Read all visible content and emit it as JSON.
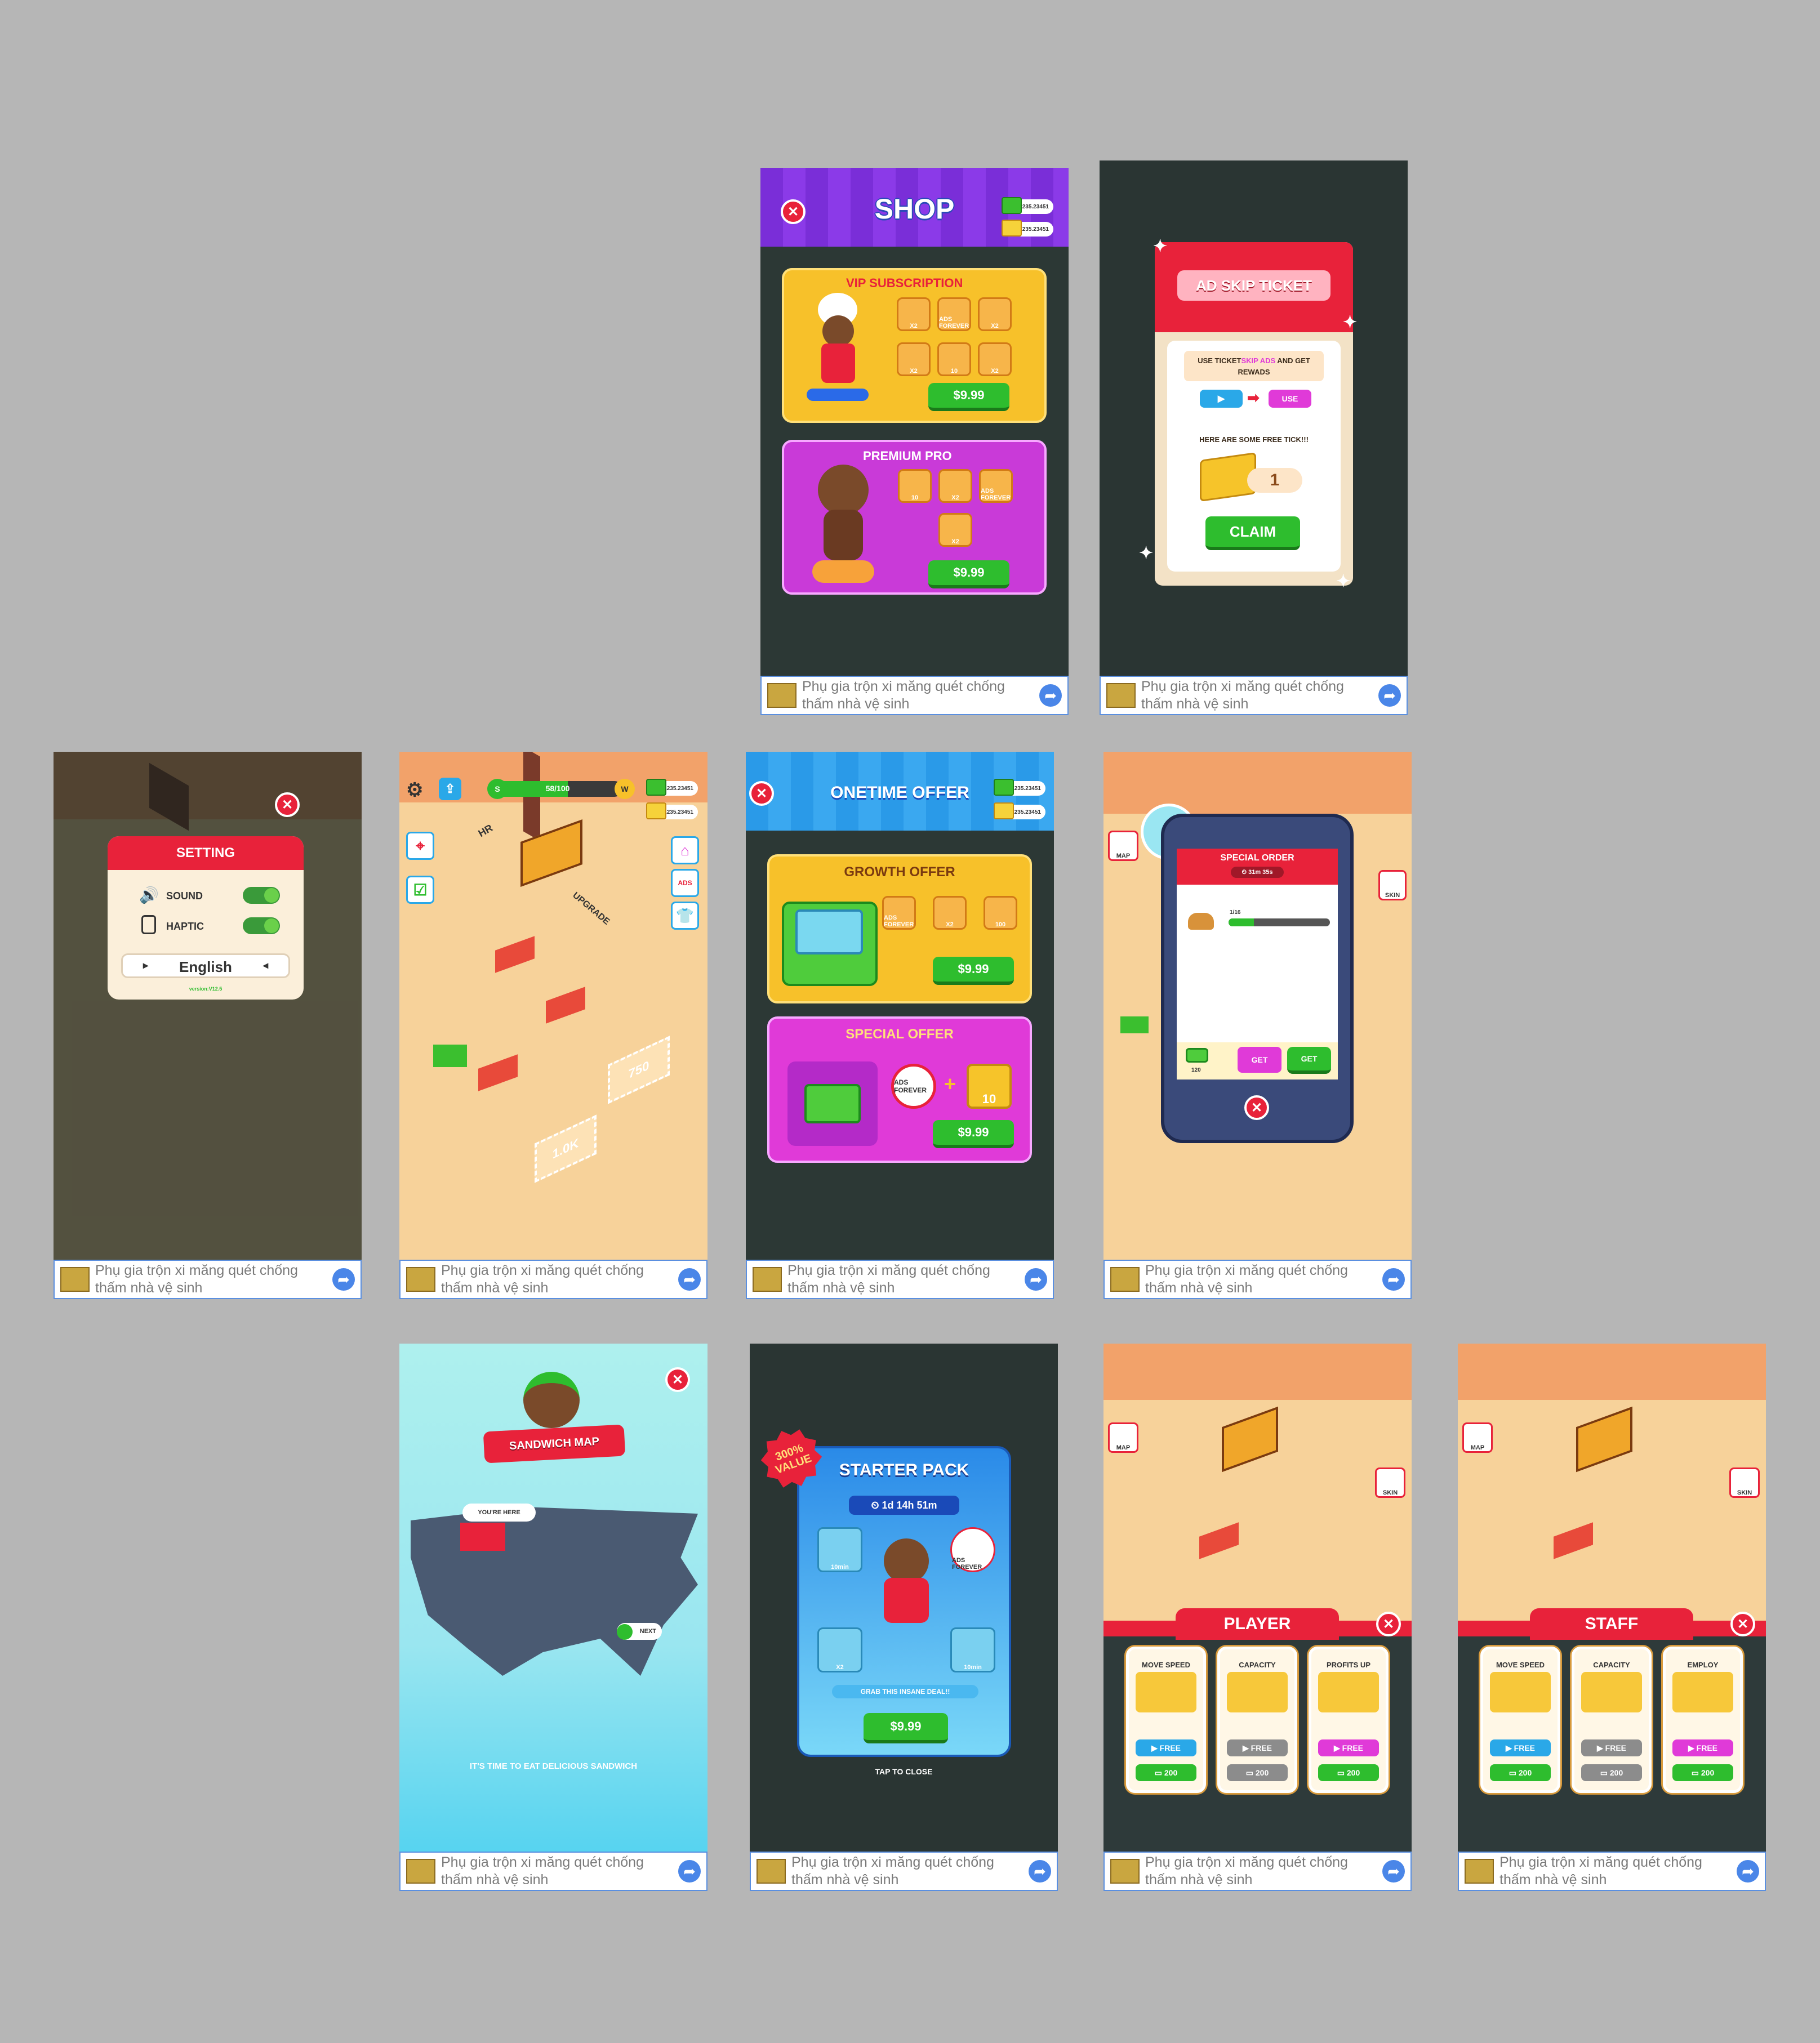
{
  "ad": {
    "line1": "Phụ gia trộn xi măng quét chống",
    "line2": "thấm nhà vệ sinh"
  },
  "currency": {
    "cash": "1235.23451",
    "tickets": "1235.23451"
  },
  "shop": {
    "title": "SHOP",
    "vip_title": "VIP SUBSCRIPTION",
    "vip_items": [
      "X2",
      "ADS FOREVER",
      "X2",
      "X2",
      "10",
      "X2"
    ],
    "vip_price": "$9.99",
    "premium_title": "PREMIUM PRO",
    "premium_items": [
      "10",
      "X2",
      "ADS FOREVER",
      "X2"
    ],
    "premium_price": "$9.99"
  },
  "ticket": {
    "title": "AD SKIP TICKET",
    "desc_a": "USE TICKET",
    "desc_b": "SKIP ADS",
    "desc_c": " AND GET REWADS",
    "use_label": "USE",
    "free_text": "HERE ARE SOME FREE TICK!!!",
    "count": "1",
    "claim": "CLAIM"
  },
  "setting": {
    "title": "SETTING",
    "sound": "SOUND",
    "haptic": "HAPTIC",
    "language": "English",
    "version": "version:V12.5"
  },
  "hud": {
    "level_s": "S",
    "progress": "58/100",
    "level_w": "W",
    "hr_label": "HR",
    "upgrade_label": "UPGRADE",
    "tile1": "750",
    "tile2": "1.0K",
    "progress_fraction": 0.58
  },
  "onetime": {
    "title": "ONETIME OFFER",
    "growth_title": "GROWTH OFFER",
    "growth_items": [
      "ADS FOREVER",
      "X2",
      "100"
    ],
    "growth_price": "$9.99",
    "special_title": "SPECIAL OFFER",
    "special_items": [
      "ADS FOREVER",
      "10"
    ],
    "special_price": "$9.99"
  },
  "special_order": {
    "title": "SPECIAL ORDER",
    "timer": "31m 35s",
    "count": "1/16",
    "reward": "120",
    "get1": "GET",
    "get2": "GET",
    "progress_fraction": 0.25
  },
  "sandwich_map": {
    "title": "SANDWICH MAP",
    "you_are_here": "YOU'RE HERE",
    "next": "NEXT",
    "message": "IT'S TIME TO EAT DELICIOUS SANDWICH"
  },
  "starter": {
    "badge": "300% VALUE",
    "title": "STARTER PACK",
    "timer": "1d 14h 51m",
    "tagline": "GRAB THIS INSANE DEAL!!",
    "price": "$9.99",
    "tap": "TAP TO CLOSE",
    "items": [
      "10min",
      "ADS FOREVER",
      "X2",
      "10min"
    ]
  },
  "player": {
    "title": "PLAYER",
    "cards": [
      {
        "name": "MOVE SPEED",
        "free": "FREE",
        "cost": "200",
        "free_color": "#2aa8e8",
        "cost_color": "#2ebd2e"
      },
      {
        "name": "CAPACITY",
        "free": "FREE",
        "cost": "200",
        "free_color": "#8c8c8c",
        "cost_color": "#8c8c8c"
      },
      {
        "name": "PROFITS UP",
        "free": "FREE",
        "cost": "200",
        "free_color": "#e03ad8",
        "cost_color": "#2ebd2e"
      }
    ]
  },
  "staff": {
    "title": "STAFF",
    "cards": [
      {
        "name": "MOVE SPEED",
        "free": "FREE",
        "cost": "200",
        "free_color": "#2aa8e8",
        "cost_color": "#2ebd2e"
      },
      {
        "name": "CAPACITY",
        "free": "FREE",
        "cost": "200",
        "free_color": "#8c8c8c",
        "cost_color": "#8c8c8c"
      },
      {
        "name": "EMPLOY",
        "free": "FREE",
        "cost": "200",
        "free_color": "#e03ad8",
        "cost_color": "#2ebd2e"
      }
    ]
  },
  "map_button": "MAP",
  "skin_button": "SKIN",
  "colors": {
    "background": "#b6b6b6",
    "shop_header": "#7a2ed8",
    "vip_card": "#f7c12a",
    "premium_card": "#c93ad8",
    "green": "#2ebd2e",
    "red": "#e8223a",
    "blue_header": "#2a9ae8",
    "map_sky": "#aef0ee"
  }
}
